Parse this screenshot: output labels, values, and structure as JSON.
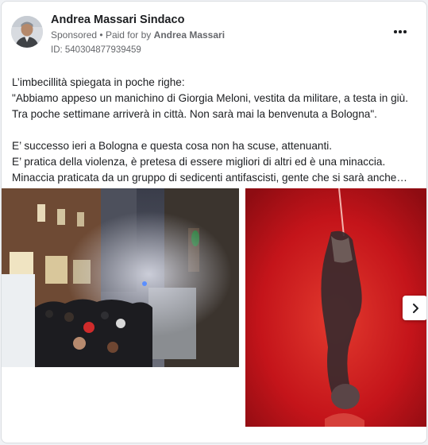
{
  "post": {
    "page_name": "Andrea Massari Sindaco",
    "sponsored_label": "Sponsored",
    "separator": "•",
    "paid_for_prefix": "Paid for by",
    "paid_for_name": "Andrea Massari",
    "ad_id": "ID: 540304877939459",
    "body": {
      "lines_paragraph_1": [
        "L’imbecillità spiegata in poche righe:",
        "\"Abbiamo appeso un manichino di Giorgia Meloni, vestita da militare, a testa in giù.",
        "Tra poche settimane arriverà in città. Non sarà mai la benvenuta a Bologna\"."
      ],
      "lines_paragraph_2": [
        "E’ successo ieri a Bologna e questa cosa non ha scuse, attenuanti.",
        "E’ pratica della violenza, è pretesa di essere migliori di altri ed è una minaccia.",
        "Minaccia praticata da un gruppo di sedicenti antifascisti, gente che si sarà anche…"
      ]
    },
    "icons": {
      "more": "more-horizontal-icon",
      "next": "chevron-right-icon"
    },
    "colors": {
      "secondary_text": "#65676b",
      "primary_text": "#1c1e21",
      "card_border": "#dadde1"
    }
  }
}
